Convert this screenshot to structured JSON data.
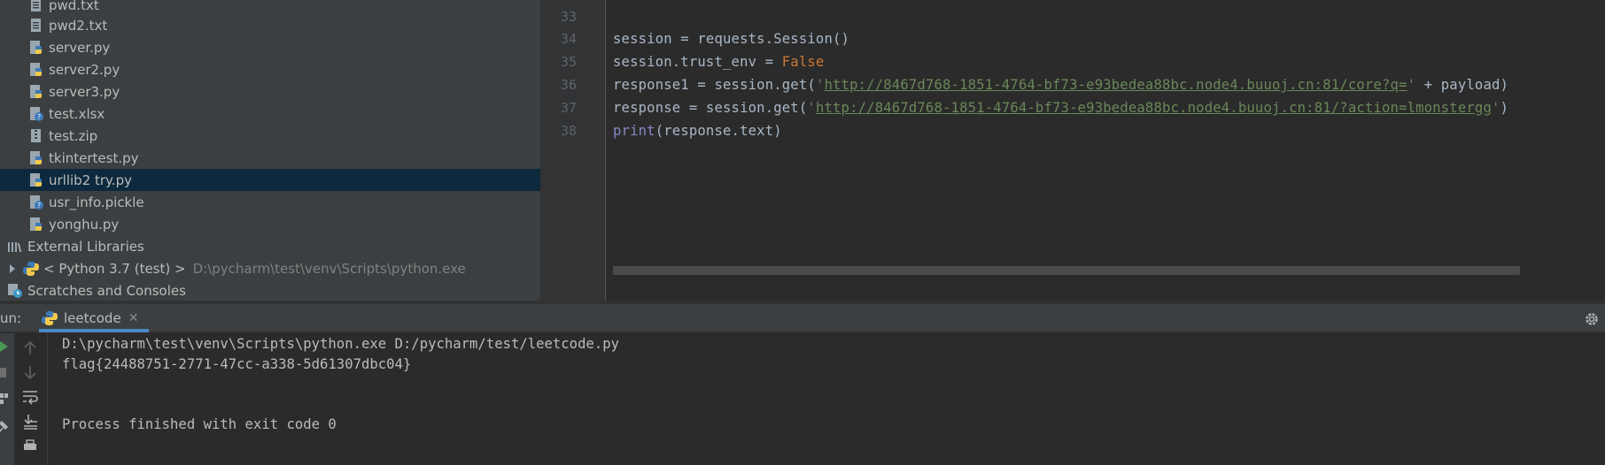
{
  "project_tree": {
    "files": [
      {
        "name": "pwd.txt",
        "type": "text"
      },
      {
        "name": "pwd2.txt",
        "type": "text"
      },
      {
        "name": "server.py",
        "type": "python"
      },
      {
        "name": "server2.py",
        "type": "python"
      },
      {
        "name": "server3.py",
        "type": "python"
      },
      {
        "name": "test.xlsx",
        "type": "unknown"
      },
      {
        "name": "test.zip",
        "type": "archive"
      },
      {
        "name": "tkintertest.py",
        "type": "python"
      },
      {
        "name": "urllib2 try.py",
        "type": "python",
        "selected": true
      },
      {
        "name": "usr_info.pickle",
        "type": "unknown"
      },
      {
        "name": "yonghu.py",
        "type": "python"
      }
    ],
    "external_libraries": "External Libraries",
    "python_sdk": {
      "label": "< Python 3.7 (test) >",
      "path": "D:\\pycharm\\test\\venv\\Scripts\\python.exe"
    },
    "scratches": "Scratches and Consoles"
  },
  "editor": {
    "line_numbers": [
      "33",
      "34",
      "35",
      "36",
      "37",
      "38"
    ],
    "code": {
      "l34": "session = requests.Session()",
      "l35_prefix": "session.trust_env = ",
      "l35_kw": "False",
      "l36_prefix": "response1 = session.get(",
      "l36_url": "http://8467d768-1851-4764-bf73-e93bedea88bc.node4.buuoj.cn:81/core?q=",
      "l36_suffix": " + payload)",
      "l37_prefix": "response = session.get(",
      "l37_url": "http://8467d768-1851-4764-bf73-e93bedea88bc.node4.buuoj.cn:81/?action=lmonstergg",
      "l37_suffix": ")",
      "l38_builtin": "print",
      "l38_rest": "(response.text)",
      "quote": "'"
    }
  },
  "run_panel": {
    "label": "un:",
    "tab_label": "leetcode",
    "close_glyph": "✕",
    "console_lines": [
      "D:\\pycharm\\test\\venv\\Scripts\\python.exe D:/pycharm/test/leetcode.py",
      "flag{24488751-2771-47cc-a338-5d61307dbc04}",
      "",
      "Process finished with exit code 0"
    ]
  },
  "colors": {
    "panel_bg": "#3c3f41",
    "editor_bg": "#2b2b2b",
    "selection": "#0d293e",
    "keyword": "#cc7832",
    "string": "#6a8759",
    "builtin": "#8888c6",
    "accent": "#4a88c7"
  }
}
